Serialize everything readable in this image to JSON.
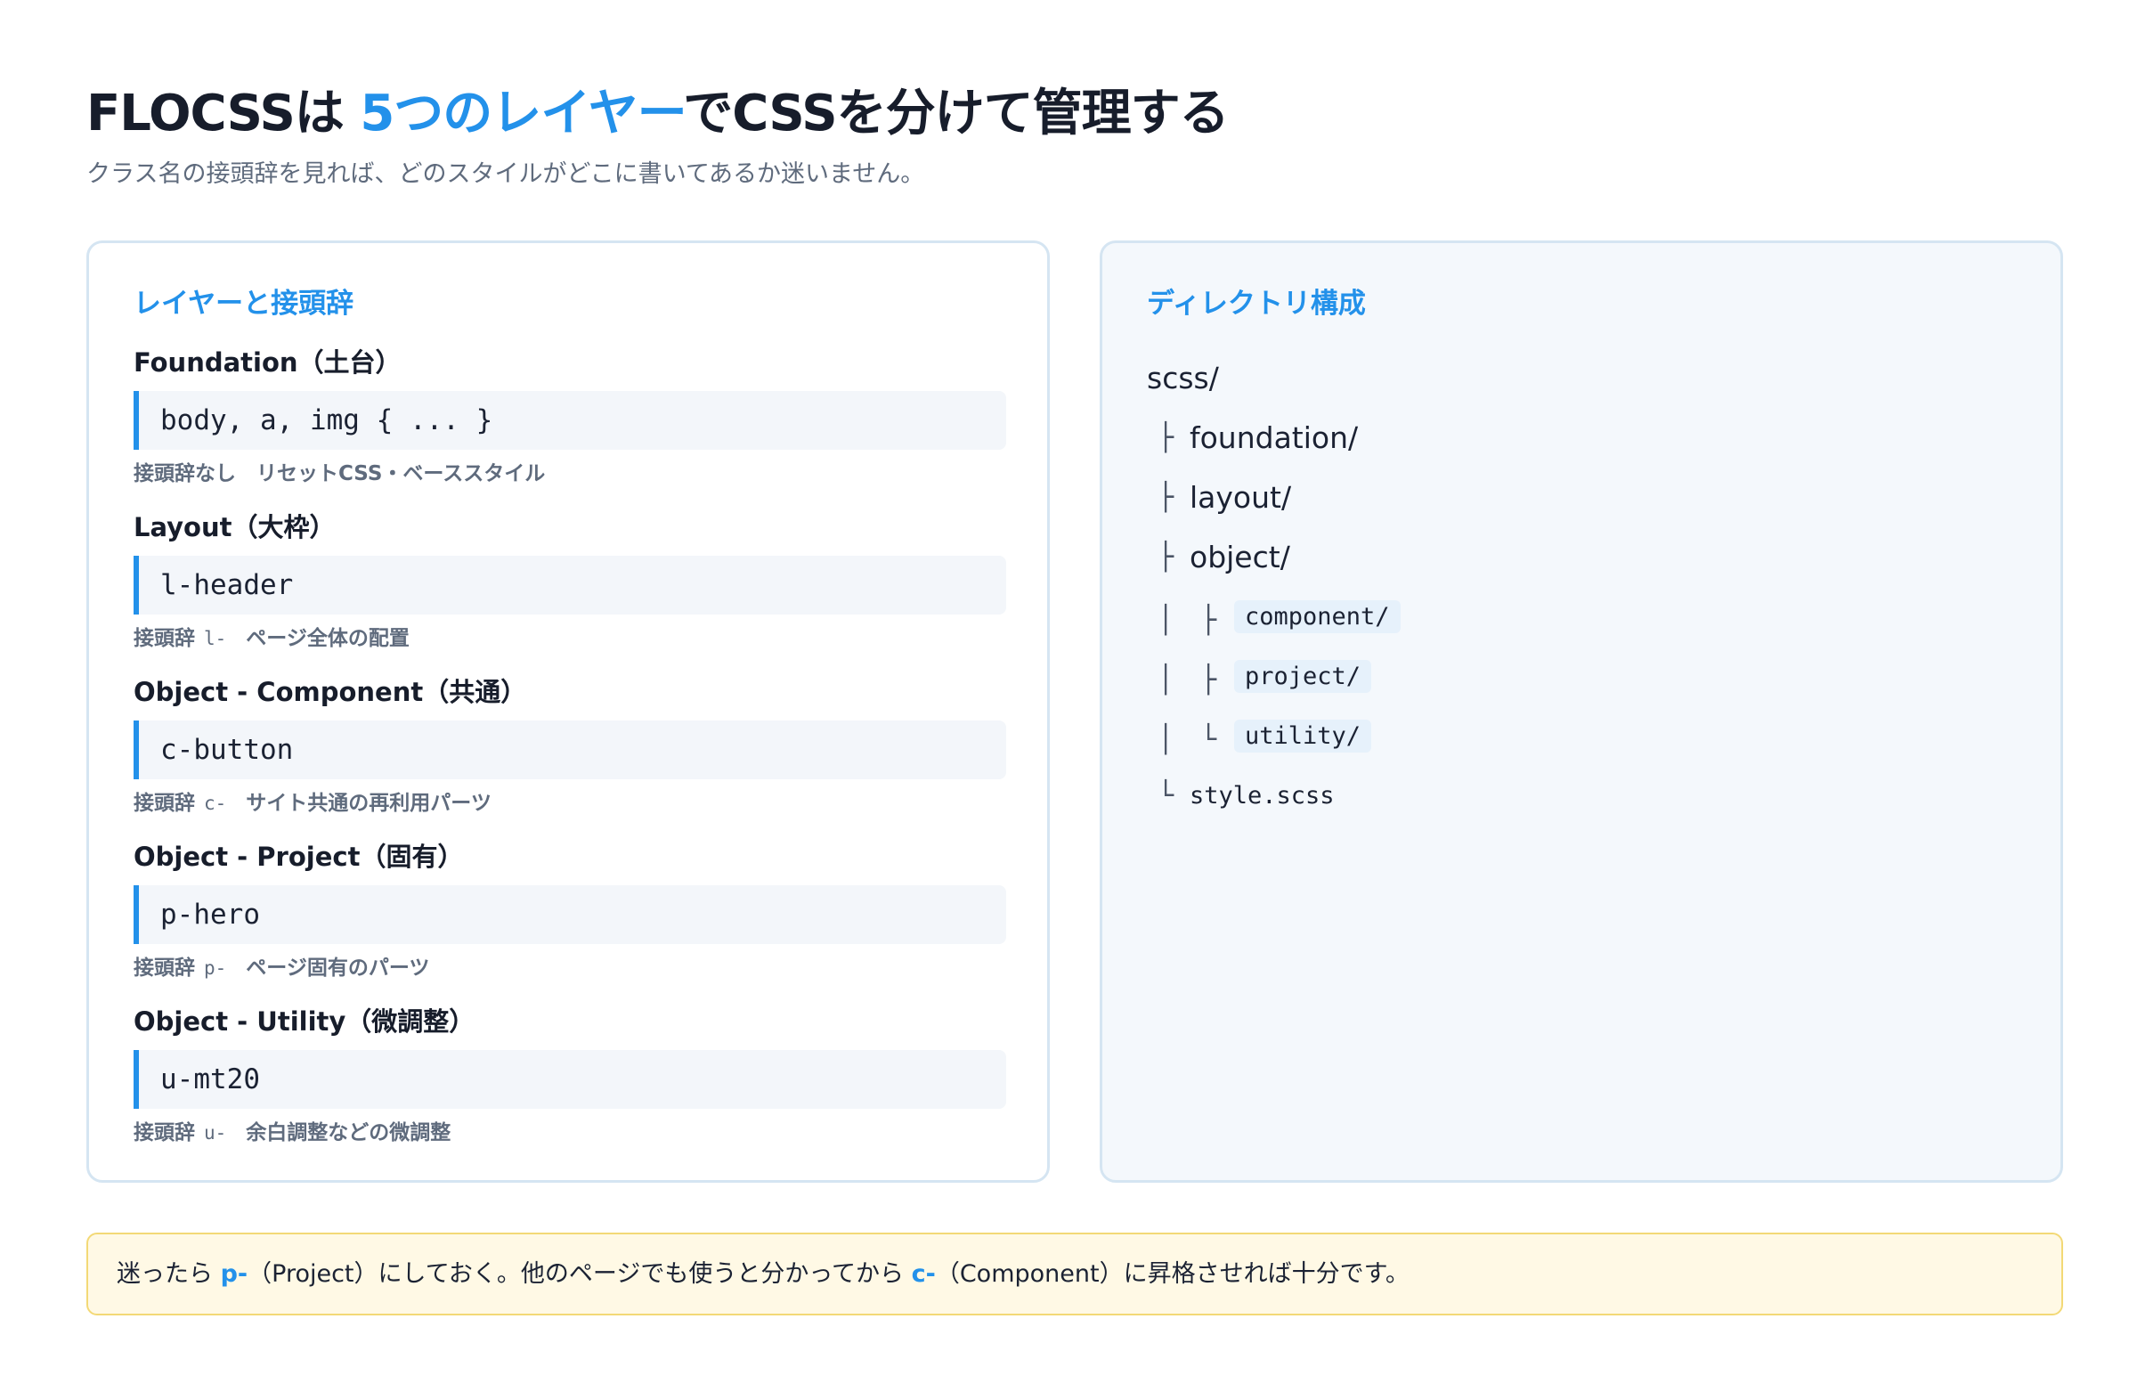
{
  "header": {
    "title_pre": "FLOCSSは",
    "title_accent": "5つのレイヤー",
    "title_post": "でCSSを分けて管理する",
    "subtitle": "クラス名の接頭辞を見れば、どのスタイルがどこに書いてあるか迷いません。",
    "accent_color": "#2391ea"
  },
  "layers_card": {
    "heading": "レイヤーと接頭辞",
    "prefix_label": "接頭辞",
    "layers": [
      {
        "name": "Foundation（土台）",
        "code": "body, a, img { ... }",
        "desc": "接頭辞なし　リセットCSS・ベーススタイル"
      },
      {
        "name": "Layout（大枠）",
        "code": "l-header",
        "prefix": "l-",
        "desc": "ページ全体の配置"
      },
      {
        "name": "Object - Component（共通）",
        "code": "c-button",
        "prefix": "c-",
        "desc": "サイト共通の再利用パーツ"
      },
      {
        "name": "Object - Project（固有）",
        "code": "p-hero",
        "prefix": "p-",
        "desc": "ページ固有のパーツ"
      },
      {
        "name": "Object - Utility（微調整）",
        "code": "u-mt20",
        "prefix": "u-",
        "desc": "余白調整などの微調整"
      }
    ]
  },
  "directory_card": {
    "heading": "ディレクトリ構成",
    "root": "scss/",
    "entries": [
      {
        "branch": "├",
        "name": "foundation/"
      },
      {
        "branch": "├",
        "name": "layout/"
      },
      {
        "branch": "├",
        "name": "object/"
      },
      {
        "branch": "│　├",
        "name": "component/"
      },
      {
        "branch": "│　├",
        "name": "project/"
      },
      {
        "branch": "│　└",
        "name": "utility/"
      },
      {
        "branch": "└",
        "name": "style.scss"
      }
    ]
  },
  "note": {
    "part1": "迷ったら",
    "code1": "p-",
    "part2": "（Project）にしておく。他のページでも使うと分かってから",
    "code2": "c-",
    "part3": "（Component）に昇格させれば十分です。"
  }
}
